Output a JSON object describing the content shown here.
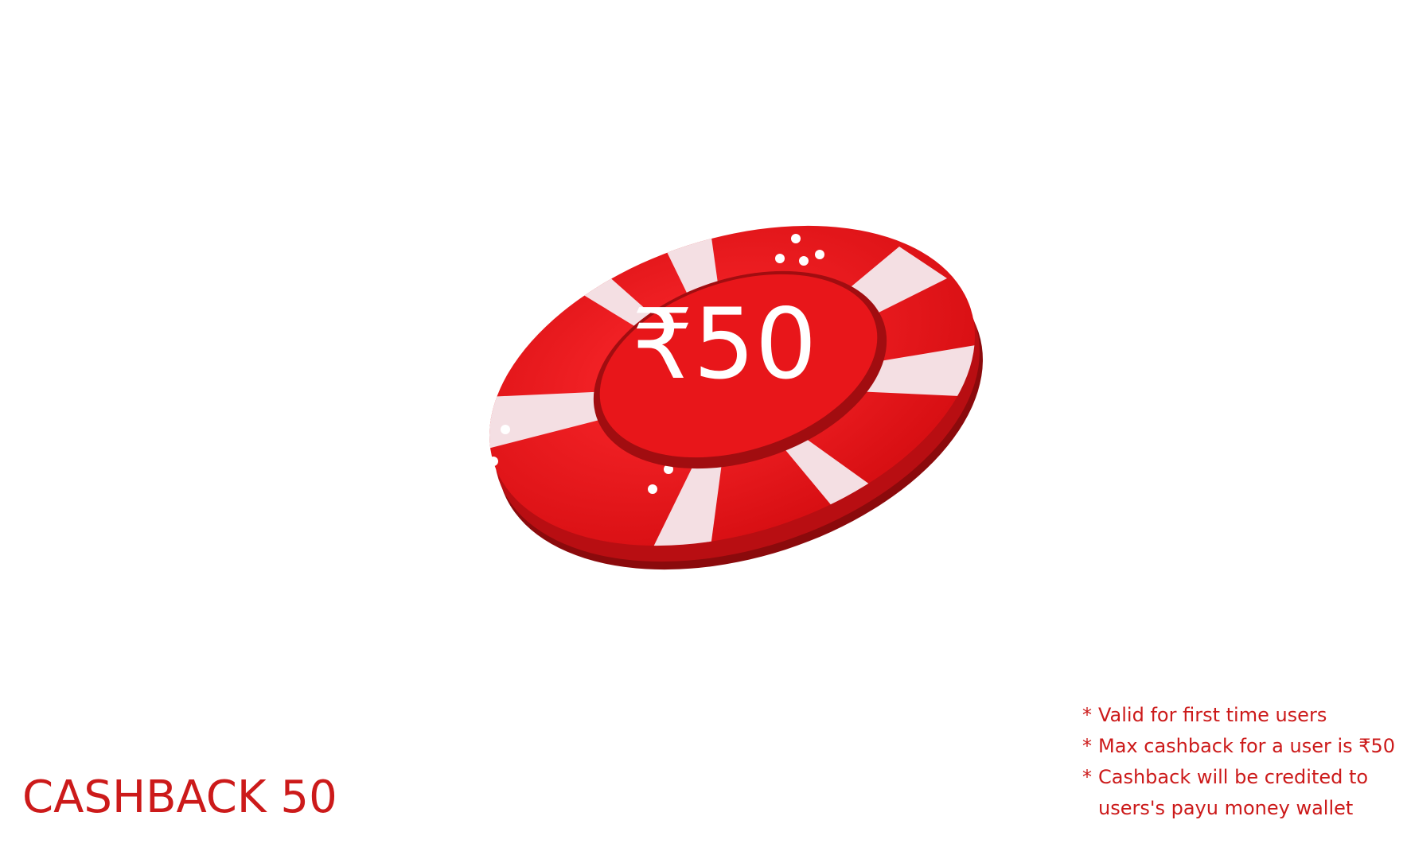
{
  "chip": {
    "amount": "₹50",
    "colors": {
      "primary": "#e8161a",
      "dark": "#a10d10",
      "stripe": "#f4dfe3",
      "edge": "#8b0a0c"
    }
  },
  "offer": {
    "title": "CASHBACK 50"
  },
  "terms": {
    "bullet": "*",
    "line1": "Valid for first time users",
    "line2": "Max cashback for a user is ₹50",
    "line3": "Cashback will be credited to",
    "line3_cont": "users's payu money wallet"
  }
}
